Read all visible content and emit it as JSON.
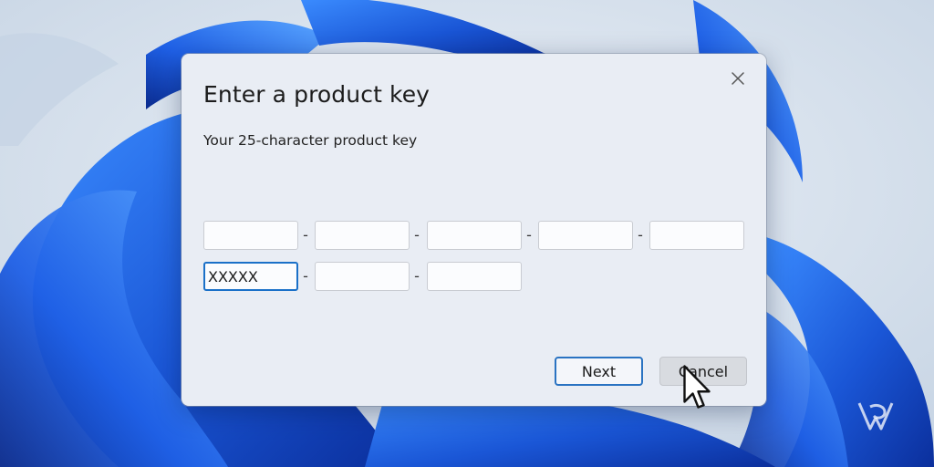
{
  "dialog": {
    "title": "Enter a product key",
    "subtitle": "Your 25-character product key",
    "fields": [
      {
        "value": "",
        "separator": "-"
      },
      {
        "value": "",
        "separator": "-"
      },
      {
        "value": "",
        "separator": "-"
      },
      {
        "value": "",
        "separator": "-"
      },
      {
        "value": ""
      },
      {
        "value": "XXXXX",
        "separator": "-"
      },
      {
        "value": "",
        "separator": "-"
      },
      {
        "value": ""
      }
    ],
    "buttons": {
      "next_label": "Next",
      "cancel_label": "Cancel"
    },
    "close_icon": "close-icon"
  },
  "colors": {
    "accent": "#1a70c8",
    "wallpaper_blue": "#1f5fe0",
    "dialog_bg": "#e9edf4"
  }
}
